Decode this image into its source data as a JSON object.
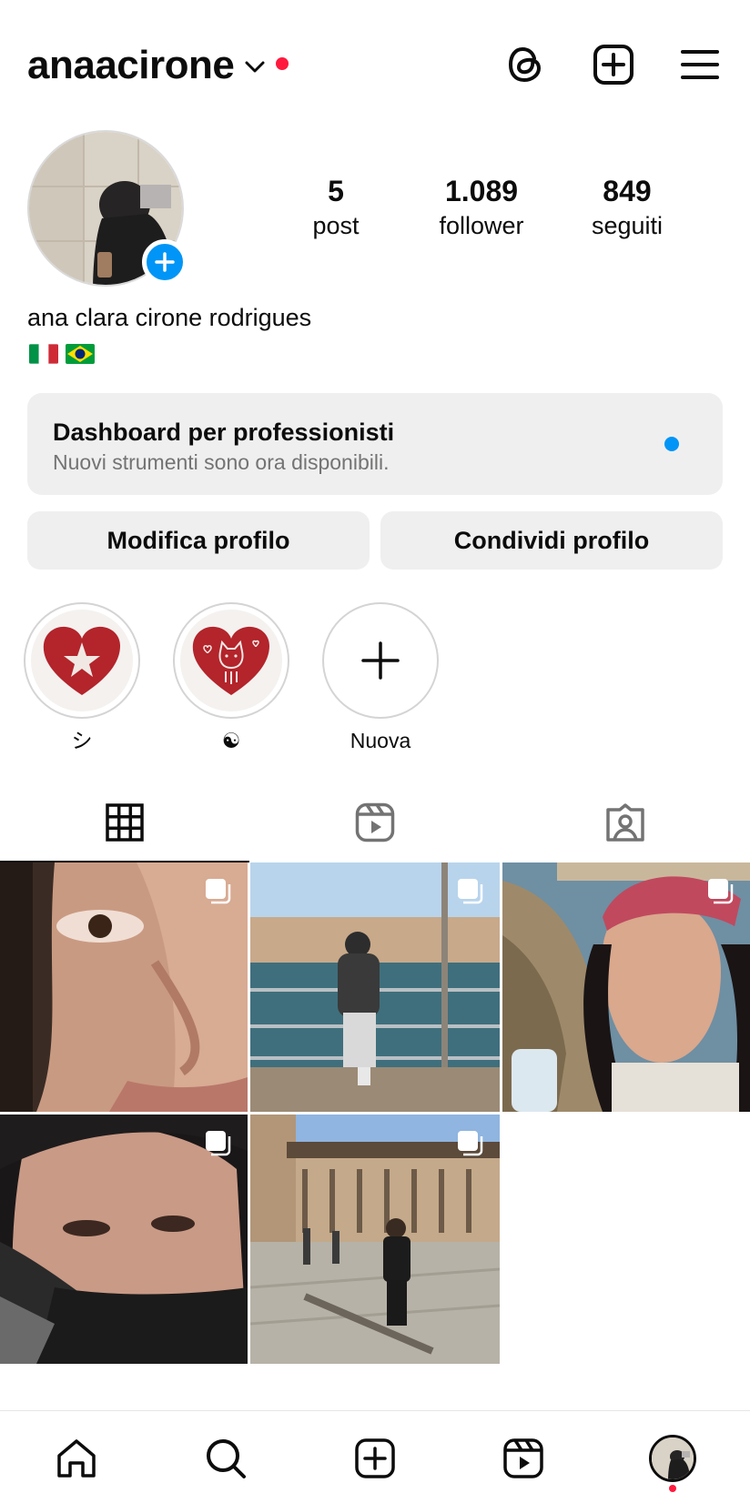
{
  "header": {
    "username": "anaacirone",
    "icons": [
      "threads-icon",
      "create-post-icon",
      "menu-icon"
    ]
  },
  "profile": {
    "stats": [
      {
        "value": "5",
        "label": "post"
      },
      {
        "value": "1.089",
        "label": "follower"
      },
      {
        "value": "849",
        "label": "seguiti"
      }
    ],
    "full_name": "ana clara cirone rodrigues",
    "bio_flags": [
      "italy-flag",
      "brazil-flag"
    ]
  },
  "dashboard": {
    "title": "Dashboard per professionisti",
    "subtitle": "Nuovi strumenti sono ora disponibili."
  },
  "buttons": {
    "edit": "Modifica profilo",
    "share": "Condividi profilo"
  },
  "highlights": [
    {
      "label": "シ",
      "icon": "heart-star-icon"
    },
    {
      "label": "☯",
      "icon": "heart-cat-icon"
    },
    {
      "label": "Nuova",
      "icon": "plus-icon"
    }
  ],
  "tabs": [
    "grid-icon",
    "reels-icon",
    "tagged-icon"
  ],
  "posts": [
    {
      "type": "multi",
      "desc": "selfie-closeup"
    },
    {
      "type": "multi",
      "desc": "venice-pier"
    },
    {
      "type": "multi",
      "desc": "selfie-cap"
    },
    {
      "type": "multi",
      "desc": "selfie-hair"
    },
    {
      "type": "multi",
      "desc": "turin-square"
    }
  ],
  "bottom_nav": [
    "home-icon",
    "search-icon",
    "create-icon",
    "reels-icon",
    "profile-avatar"
  ],
  "colors": {
    "accent": "#0095f6",
    "notification": "#ff1a3d",
    "button_bg": "#efeff0",
    "highlight_red": "#b3242b"
  }
}
